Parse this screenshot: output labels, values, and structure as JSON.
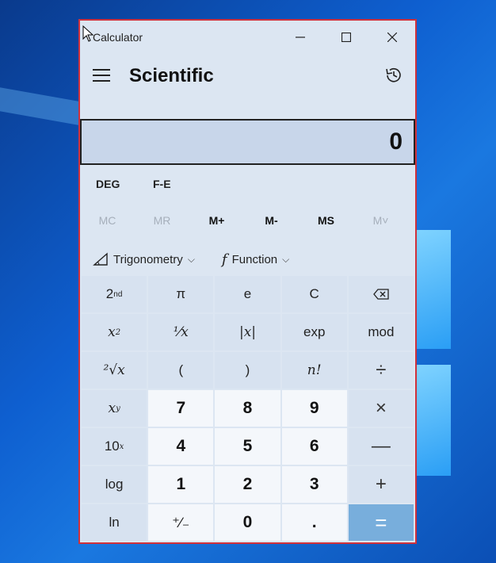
{
  "window": {
    "title": "Calculator",
    "minimize": "—",
    "maximize": "☐",
    "close": "✕"
  },
  "header": {
    "mode": "Scientific"
  },
  "display": {
    "value": "0"
  },
  "angle": {
    "unit": "DEG",
    "notation": "F-E"
  },
  "memory": [
    "MC",
    "MR",
    "M+",
    "M-",
    "MS",
    "M˅"
  ],
  "functions": {
    "trig": "Trigonometry",
    "func": "Function"
  },
  "keys": {
    "second": "2",
    "second_sup": "nd",
    "pi": "π",
    "e": "e",
    "clear": "C",
    "backspace": "⌫",
    "square": "x",
    "square_sup": "2",
    "reciprocal": "⅟x",
    "abs": "|x|",
    "exp": "exp",
    "mod": "mod",
    "sqrt": "²√x",
    "lparen": "(",
    "rparen": ")",
    "fact": "n!",
    "divide": "÷",
    "power": "x",
    "power_sup": "y",
    "seven": "7",
    "eight": "8",
    "nine": "9",
    "multiply": "×",
    "tenpow": "10",
    "tenpow_sup": "x",
    "four": "4",
    "five": "5",
    "six": "6",
    "minus": "—",
    "log": "log",
    "one": "1",
    "two": "2",
    "three": "3",
    "plus": "+",
    "ln": "ln",
    "negate": "⁺∕₋",
    "zero": "0",
    "decimal": ".",
    "equals": "="
  }
}
